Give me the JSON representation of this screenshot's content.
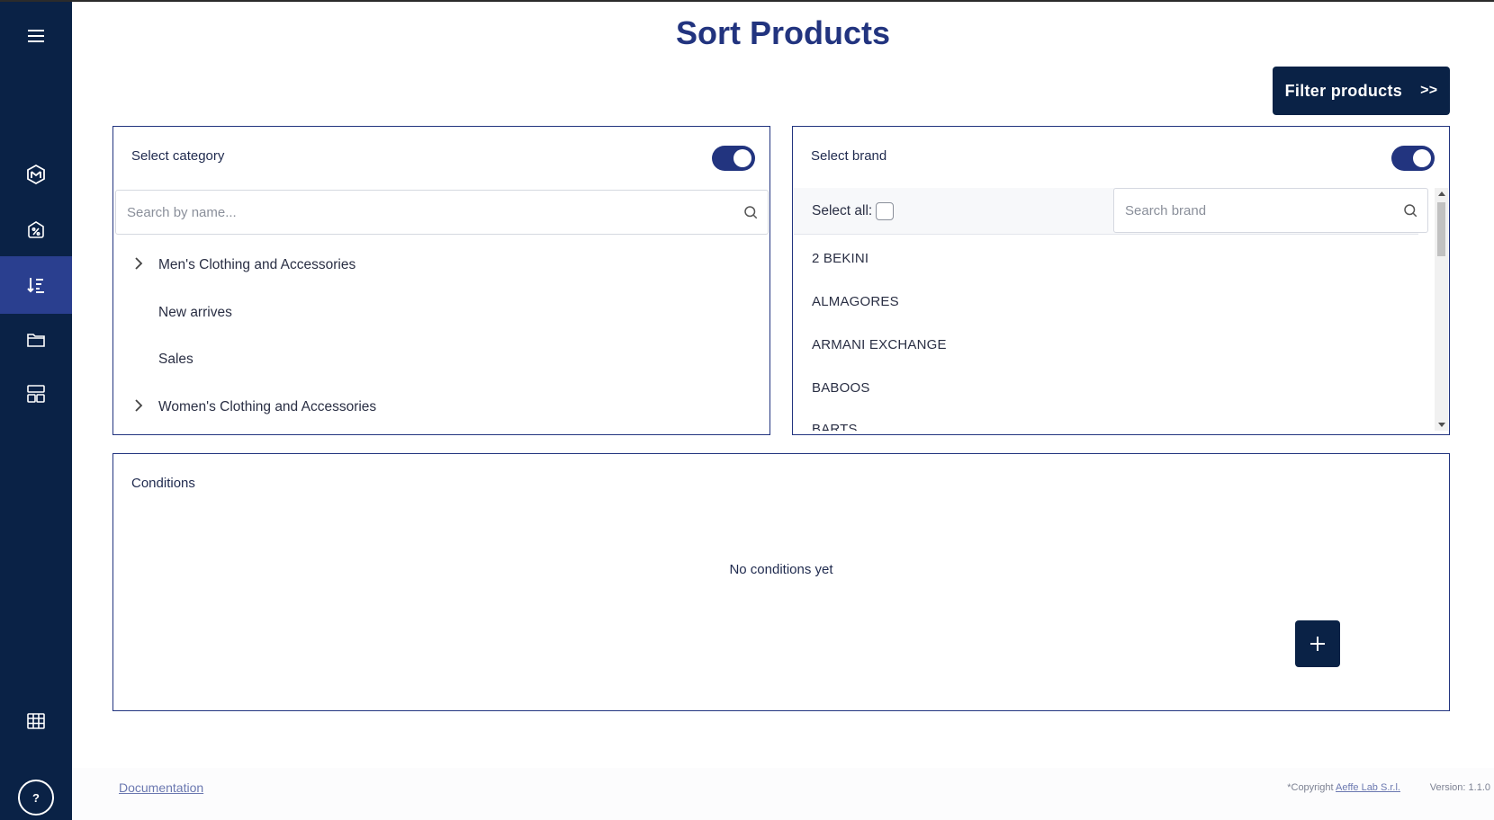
{
  "page": {
    "title": "Sort Products"
  },
  "toolbar": {
    "filter_label": "Filter products",
    "filter_arrows": ">>"
  },
  "category_panel": {
    "title": "Select category",
    "toggle_on": true,
    "search_placeholder": "Search by name...",
    "items": [
      {
        "label": "Men's Clothing and Accessories",
        "expandable": true
      },
      {
        "label": "New arrives",
        "expandable": false
      },
      {
        "label": "Sales",
        "expandable": false
      },
      {
        "label": "Women's Clothing and Accessories",
        "expandable": true
      }
    ]
  },
  "brand_panel": {
    "title": "Select brand",
    "toggle_on": true,
    "select_all_label": "Select all:",
    "search_placeholder": "Search brand",
    "items": [
      "2 BEKINI",
      "ALMAGORES",
      "ARMANI EXCHANGE",
      "BABOOS",
      "BARTS"
    ]
  },
  "conditions_panel": {
    "title": "Conditions",
    "empty_message": "No conditions yet",
    "add_icon": "plus-icon"
  },
  "sidebar": {
    "icons": [
      "menu-icon",
      "logo-icon",
      "discount-tag-icon",
      "sort-icon",
      "folder-icon",
      "layout-icon",
      "table-icon"
    ],
    "active": "sort-icon",
    "help_label": "?"
  },
  "footer": {
    "documentation_label": "Documentation",
    "copyright_prefix": "*Copyright",
    "copyright_company": "Aeffe Lab S.r.l.",
    "version": "Version: 1.1.0"
  },
  "colors": {
    "sidebar": "#0a2246",
    "accent": "#22347f",
    "active": "#2a3f8f"
  }
}
